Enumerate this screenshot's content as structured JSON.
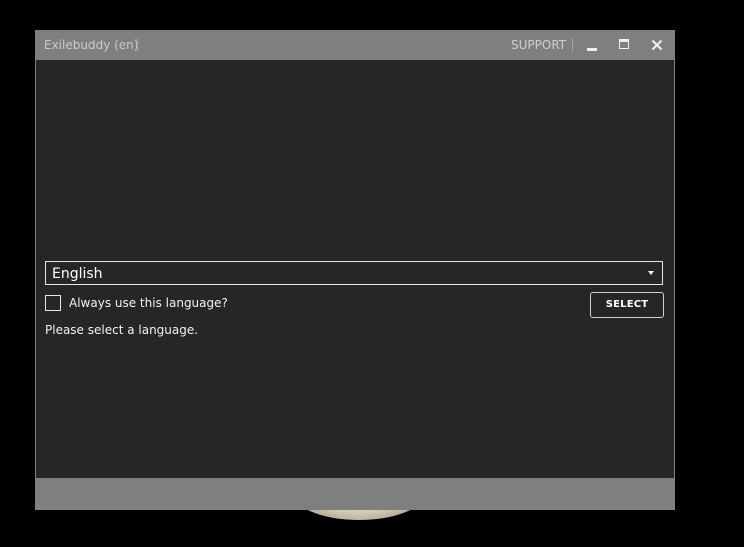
{
  "window": {
    "title": "Exilebuddy (en)",
    "support_label": "SUPPORT",
    "minimize_icon": "minimize-icon",
    "maximize_icon": "maximize-icon",
    "close_icon": "close-icon"
  },
  "language": {
    "selected": "English",
    "dropdown_icon": "chevron-down-icon"
  },
  "always_use": {
    "label": "Always use this language?",
    "checked": false
  },
  "select_button": {
    "label": "SELECT"
  },
  "status": {
    "message": "Please select a language."
  },
  "colors": {
    "titlebar": "#7f7f7f",
    "content_bg": "#262626",
    "text": "#ffffff"
  }
}
